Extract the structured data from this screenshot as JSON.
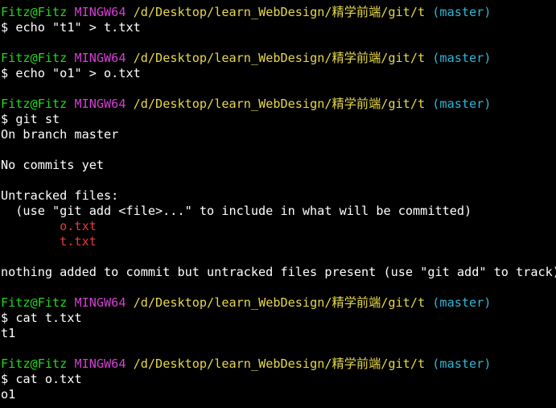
{
  "prompt": {
    "user_host": "Fitz@Fitz",
    "system": "MINGW64",
    "path": "/d/Desktop/learn_WebDesign/精学前端/git/t",
    "branch": "(master)",
    "symbol": "$"
  },
  "colors": {
    "background": "#000000",
    "text": "#ffffff",
    "user_host": "#1fd91f",
    "system": "#d43fd4",
    "path": "#e6d84a",
    "branch": "#2fb8d8",
    "untracked_file": "#e53b3b"
  },
  "session": [
    {
      "command": "echo \"t1\" > t.txt",
      "output": []
    },
    {
      "command": "echo \"o1\" > o.txt",
      "output": []
    },
    {
      "command": "git st",
      "output_lines": {
        "on_branch": "On branch master",
        "no_commits": "No commits yet",
        "untracked_header": "Untracked files:",
        "hint": "(use \"git add <file>...\" to include in what will be committed)",
        "file_1": "o.txt",
        "file_2": "t.txt",
        "summary": "nothing added to commit but untracked files present (use \"git add\" to track)"
      }
    },
    {
      "command": "cat t.txt",
      "output_lines": {
        "line_1": "t1"
      }
    },
    {
      "command": "cat o.txt",
      "output_lines": {
        "line_1": "o1"
      }
    }
  ]
}
